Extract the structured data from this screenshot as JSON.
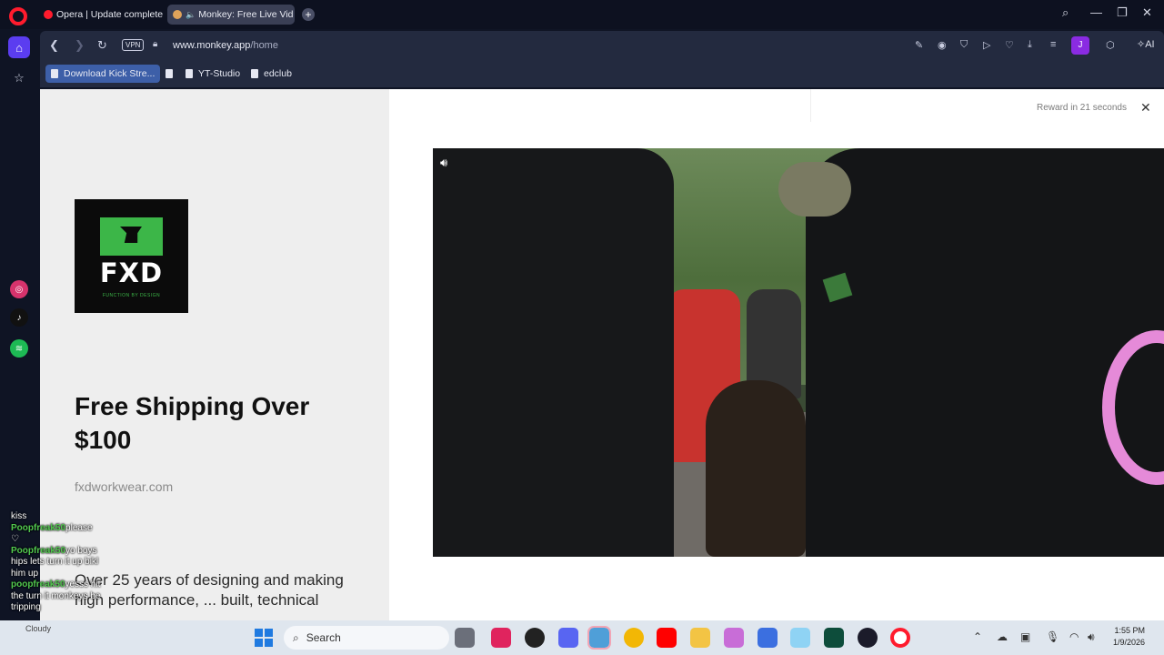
{
  "browser": {
    "tabs": [
      {
        "label": "Opera | Update complete"
      },
      {
        "label": "Monkey: Free Live Vid"
      }
    ],
    "address": {
      "vpn": "VPN",
      "domain": "www.monkey.app",
      "path": "/home"
    },
    "profile_initial": "J",
    "ai_label": "AI",
    "bookmarks": [
      {
        "label": "Download Kick Stre..."
      },
      {
        "label": ""
      },
      {
        "label": "YT-Studio"
      },
      {
        "label": "edclub"
      }
    ]
  },
  "ad": {
    "logo_text": "FXD",
    "logo_sub": "FUNCTION BY DESIGN",
    "headline": "Free Shipping Over $100",
    "domain": "fxdworkwear.com",
    "body": "Over 25 years of designing and making high performance, ... built, technical"
  },
  "reward": {
    "text": "Reward in 21 seconds"
  },
  "chat": {
    "lines": [
      {
        "user": "",
        "text": "kiss"
      },
      {
        "user": "Poopfreak50",
        "text": "please"
      },
      {
        "user": "",
        "text": "♡"
      },
      {
        "user": "Poopfreak50",
        "text": "yo boys"
      },
      {
        "user": "",
        "text": "hips lets turn it up bikl"
      },
      {
        "user": "",
        "text": "him up"
      },
      {
        "user": "poopfreak50",
        "text": "yesss hit"
      },
      {
        "user": "",
        "text": "the turn it monkeys be"
      },
      {
        "user": "",
        "text": "tripping"
      }
    ]
  },
  "taskbar": {
    "weather_label": "Cloudy",
    "search_placeholder": "Search",
    "time": "1:55 PM",
    "date": "1/9/2026"
  },
  "colors": {
    "opera_red": "#ff1b2d",
    "sidebar_accent": "#5b3df0",
    "brand_green": "#3cb648",
    "chat_username": "#52c94f"
  }
}
